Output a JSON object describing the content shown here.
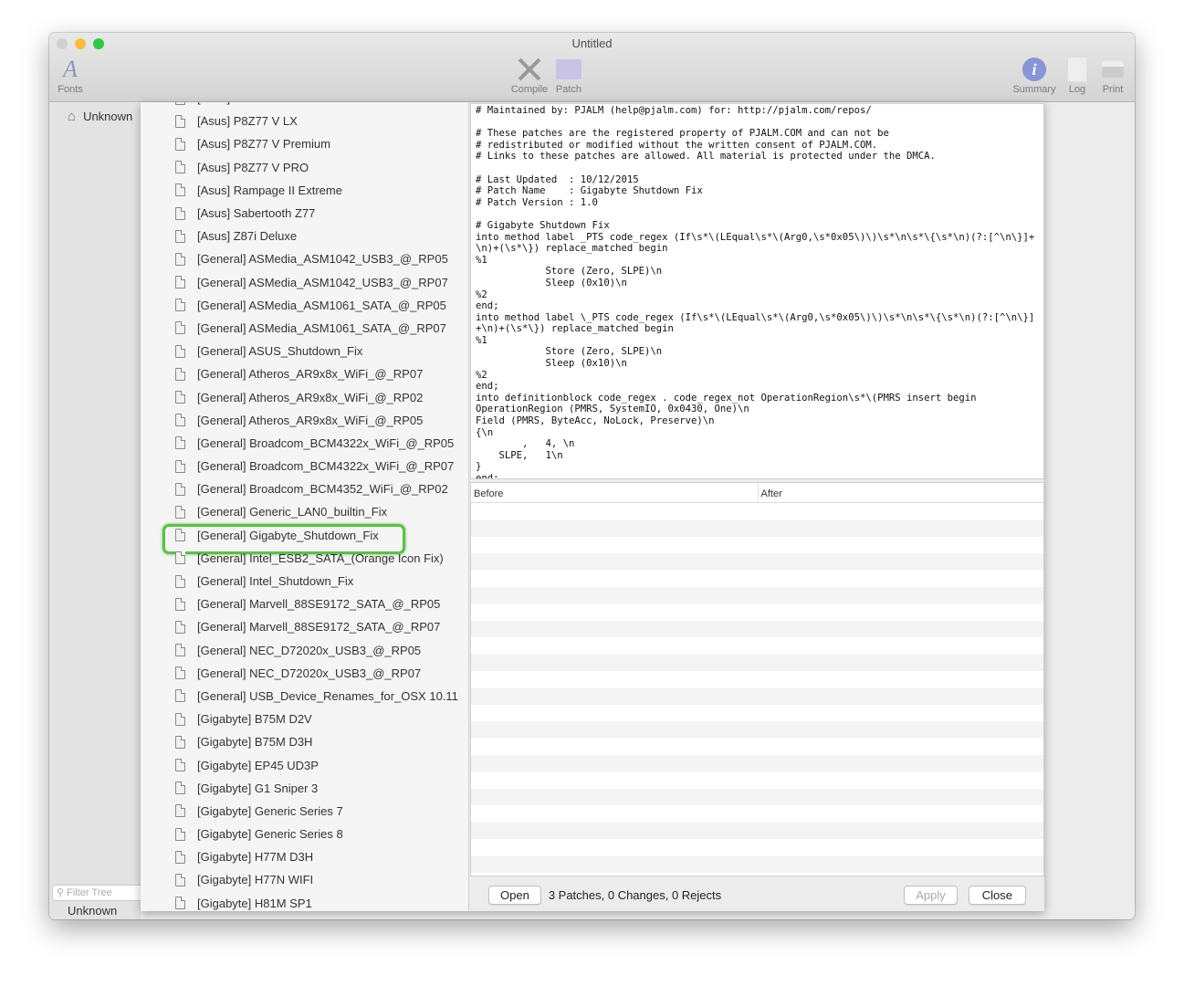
{
  "window": {
    "title": "Untitled"
  },
  "toolbar": {
    "fonts": "Fonts",
    "compile": "Compile",
    "patch": "Patch",
    "summary": "Summary",
    "log": "Log",
    "print": "Print"
  },
  "sidebar": {
    "item": "Unknown",
    "filter_placeholder": "Filter Tree",
    "bottom_label": "Unknown"
  },
  "patch_list": [
    "[Asus] ...",
    "[Asus] P8Z77 V LX",
    "[Asus] P8Z77 V Premium",
    "[Asus] P8Z77 V PRO",
    "[Asus] Rampage II Extreme",
    "[Asus] Sabertooth Z77",
    "[Asus] Z87i Deluxe",
    "[General] ASMedia_ASM1042_USB3_@_RP05",
    "[General] ASMedia_ASM1042_USB3_@_RP07",
    "[General] ASMedia_ASM1061_SATA_@_RP05",
    "[General] ASMedia_ASM1061_SATA_@_RP07",
    "[General] ASUS_Shutdown_Fix",
    "[General] Atheros_AR9x8x_WiFi_@_RP07",
    "[General] Atheros_AR9x8x_WiFi_@_RP02",
    "[General] Atheros_AR9x8x_WiFi_@_RP05",
    "[General] Broadcom_BCM4322x_WiFi_@_RP05",
    "[General] Broadcom_BCM4322x_WiFi_@_RP07",
    "[General] Broadcom_BCM4352_WiFi_@_RP02",
    "[General] Generic_LAN0_builtin_Fix",
    "[General] Gigabyte_Shutdown_Fix",
    "[General] Intel_ESB2_SATA_(Orange Icon Fix)",
    "[General] Intel_Shutdown_Fix",
    "[General] Marvell_88SE9172_SATA_@_RP05",
    "[General] Marvell_88SE9172_SATA_@_RP07",
    "[General] NEC_D72020x_USB3_@_RP05",
    "[General] NEC_D72020x_USB3_@_RP07",
    "[General] USB_Device_Renames_for_OSX 10.11",
    "[Gigabyte] B75M D2V",
    "[Gigabyte] B75M D3H",
    "[Gigabyte] EP45 UD3P",
    "[Gigabyte] G1 Sniper 3",
    "[Gigabyte] Generic Series 7",
    "[Gigabyte] Generic Series 8",
    "[Gigabyte] H77M D3H",
    "[Gigabyte] H77N WIFI",
    "[Gigabyte] H81M SP1"
  ],
  "selected_index": 19,
  "code": "# Maintained by: PJALM (help@pjalm.com) for: http://pjalm.com/repos/\n\n# These patches are the registered property of PJALM.COM and can not be\n# redistributed or modified without the written consent of PJALM.COM.\n# Links to these patches are allowed. All material is protected under the DMCA.\n\n# Last Updated  : 10/12/2015\n# Patch Name    : Gigabyte Shutdown Fix\n# Patch Version : 1.0\n\n# Gigabyte Shutdown Fix\ninto method label _PTS code_regex (If\\s*\\(LEqual\\s*\\(Arg0,\\s*0x05\\)\\)\\s*\\n\\s*\\{\\s*\\n)(?:[^\\n\\}]+\n\\n)+(\\s*\\}) replace_matched begin\n%1\n            Store (Zero, SLPE)\\n\n            Sleep (0x10)\\n\n%2\nend;\ninto method label \\_PTS code_regex (If\\s*\\(LEqual\\s*\\(Arg0,\\s*0x05\\)\\)\\s*\\n\\s*\\{\\s*\\n)(?:[^\\n\\}]\n+\\n)+(\\s*\\}) replace_matched begin\n%1\n            Store (Zero, SLPE)\\n\n            Sleep (0x10)\\n\n%2\nend;\ninto definitionblock code_regex . code_regex_not OperationRegion\\s*\\(PMRS insert begin\nOperationRegion (PMRS, SystemIO, 0x0430, One)\\n\nField (PMRS, ByteAcc, NoLock, Preserve)\\n\n{\\n\n        ,   4, \\n\n    SLPE,   1\\n\n}\nend;",
  "table": {
    "before": "Before",
    "after": "After"
  },
  "footer": {
    "open": "Open",
    "status": "3 Patches, 0 Changes, 0 Rejects",
    "apply": "Apply",
    "close": "Close"
  }
}
